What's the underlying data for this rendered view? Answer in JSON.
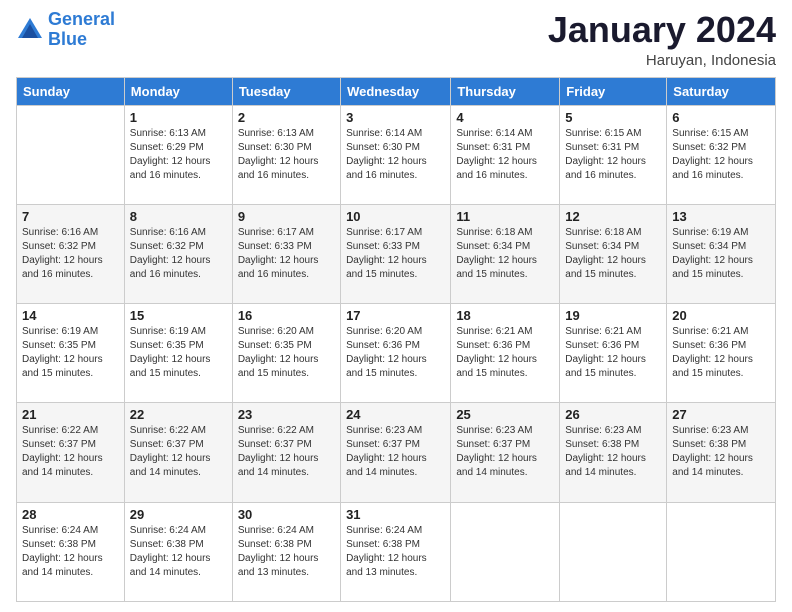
{
  "logo": {
    "line1": "General",
    "line2": "Blue"
  },
  "title": "January 2024",
  "subtitle": "Haruyan, Indonesia",
  "days_of_week": [
    "Sunday",
    "Monday",
    "Tuesday",
    "Wednesday",
    "Thursday",
    "Friday",
    "Saturday"
  ],
  "weeks": [
    [
      {
        "num": "",
        "sunrise": "",
        "sunset": "",
        "daylight": ""
      },
      {
        "num": "1",
        "sunrise": "Sunrise: 6:13 AM",
        "sunset": "Sunset: 6:29 PM",
        "daylight": "Daylight: 12 hours and 16 minutes."
      },
      {
        "num": "2",
        "sunrise": "Sunrise: 6:13 AM",
        "sunset": "Sunset: 6:30 PM",
        "daylight": "Daylight: 12 hours and 16 minutes."
      },
      {
        "num": "3",
        "sunrise": "Sunrise: 6:14 AM",
        "sunset": "Sunset: 6:30 PM",
        "daylight": "Daylight: 12 hours and 16 minutes."
      },
      {
        "num": "4",
        "sunrise": "Sunrise: 6:14 AM",
        "sunset": "Sunset: 6:31 PM",
        "daylight": "Daylight: 12 hours and 16 minutes."
      },
      {
        "num": "5",
        "sunrise": "Sunrise: 6:15 AM",
        "sunset": "Sunset: 6:31 PM",
        "daylight": "Daylight: 12 hours and 16 minutes."
      },
      {
        "num": "6",
        "sunrise": "Sunrise: 6:15 AM",
        "sunset": "Sunset: 6:32 PM",
        "daylight": "Daylight: 12 hours and 16 minutes."
      }
    ],
    [
      {
        "num": "7",
        "sunrise": "Sunrise: 6:16 AM",
        "sunset": "Sunset: 6:32 PM",
        "daylight": "Daylight: 12 hours and 16 minutes."
      },
      {
        "num": "8",
        "sunrise": "Sunrise: 6:16 AM",
        "sunset": "Sunset: 6:32 PM",
        "daylight": "Daylight: 12 hours and 16 minutes."
      },
      {
        "num": "9",
        "sunrise": "Sunrise: 6:17 AM",
        "sunset": "Sunset: 6:33 PM",
        "daylight": "Daylight: 12 hours and 16 minutes."
      },
      {
        "num": "10",
        "sunrise": "Sunrise: 6:17 AM",
        "sunset": "Sunset: 6:33 PM",
        "daylight": "Daylight: 12 hours and 15 minutes."
      },
      {
        "num": "11",
        "sunrise": "Sunrise: 6:18 AM",
        "sunset": "Sunset: 6:34 PM",
        "daylight": "Daylight: 12 hours and 15 minutes."
      },
      {
        "num": "12",
        "sunrise": "Sunrise: 6:18 AM",
        "sunset": "Sunset: 6:34 PM",
        "daylight": "Daylight: 12 hours and 15 minutes."
      },
      {
        "num": "13",
        "sunrise": "Sunrise: 6:19 AM",
        "sunset": "Sunset: 6:34 PM",
        "daylight": "Daylight: 12 hours and 15 minutes."
      }
    ],
    [
      {
        "num": "14",
        "sunrise": "Sunrise: 6:19 AM",
        "sunset": "Sunset: 6:35 PM",
        "daylight": "Daylight: 12 hours and 15 minutes."
      },
      {
        "num": "15",
        "sunrise": "Sunrise: 6:19 AM",
        "sunset": "Sunset: 6:35 PM",
        "daylight": "Daylight: 12 hours and 15 minutes."
      },
      {
        "num": "16",
        "sunrise": "Sunrise: 6:20 AM",
        "sunset": "Sunset: 6:35 PM",
        "daylight": "Daylight: 12 hours and 15 minutes."
      },
      {
        "num": "17",
        "sunrise": "Sunrise: 6:20 AM",
        "sunset": "Sunset: 6:36 PM",
        "daylight": "Daylight: 12 hours and 15 minutes."
      },
      {
        "num": "18",
        "sunrise": "Sunrise: 6:21 AM",
        "sunset": "Sunset: 6:36 PM",
        "daylight": "Daylight: 12 hours and 15 minutes."
      },
      {
        "num": "19",
        "sunrise": "Sunrise: 6:21 AM",
        "sunset": "Sunset: 6:36 PM",
        "daylight": "Daylight: 12 hours and 15 minutes."
      },
      {
        "num": "20",
        "sunrise": "Sunrise: 6:21 AM",
        "sunset": "Sunset: 6:36 PM",
        "daylight": "Daylight: 12 hours and 15 minutes."
      }
    ],
    [
      {
        "num": "21",
        "sunrise": "Sunrise: 6:22 AM",
        "sunset": "Sunset: 6:37 PM",
        "daylight": "Daylight: 12 hours and 14 minutes."
      },
      {
        "num": "22",
        "sunrise": "Sunrise: 6:22 AM",
        "sunset": "Sunset: 6:37 PM",
        "daylight": "Daylight: 12 hours and 14 minutes."
      },
      {
        "num": "23",
        "sunrise": "Sunrise: 6:22 AM",
        "sunset": "Sunset: 6:37 PM",
        "daylight": "Daylight: 12 hours and 14 minutes."
      },
      {
        "num": "24",
        "sunrise": "Sunrise: 6:23 AM",
        "sunset": "Sunset: 6:37 PM",
        "daylight": "Daylight: 12 hours and 14 minutes."
      },
      {
        "num": "25",
        "sunrise": "Sunrise: 6:23 AM",
        "sunset": "Sunset: 6:37 PM",
        "daylight": "Daylight: 12 hours and 14 minutes."
      },
      {
        "num": "26",
        "sunrise": "Sunrise: 6:23 AM",
        "sunset": "Sunset: 6:38 PM",
        "daylight": "Daylight: 12 hours and 14 minutes."
      },
      {
        "num": "27",
        "sunrise": "Sunrise: 6:23 AM",
        "sunset": "Sunset: 6:38 PM",
        "daylight": "Daylight: 12 hours and 14 minutes."
      }
    ],
    [
      {
        "num": "28",
        "sunrise": "Sunrise: 6:24 AM",
        "sunset": "Sunset: 6:38 PM",
        "daylight": "Daylight: 12 hours and 14 minutes."
      },
      {
        "num": "29",
        "sunrise": "Sunrise: 6:24 AM",
        "sunset": "Sunset: 6:38 PM",
        "daylight": "Daylight: 12 hours and 14 minutes."
      },
      {
        "num": "30",
        "sunrise": "Sunrise: 6:24 AM",
        "sunset": "Sunset: 6:38 PM",
        "daylight": "Daylight: 12 hours and 13 minutes."
      },
      {
        "num": "31",
        "sunrise": "Sunrise: 6:24 AM",
        "sunset": "Sunset: 6:38 PM",
        "daylight": "Daylight: 12 hours and 13 minutes."
      },
      {
        "num": "",
        "sunrise": "",
        "sunset": "",
        "daylight": ""
      },
      {
        "num": "",
        "sunrise": "",
        "sunset": "",
        "daylight": ""
      },
      {
        "num": "",
        "sunrise": "",
        "sunset": "",
        "daylight": ""
      }
    ]
  ]
}
